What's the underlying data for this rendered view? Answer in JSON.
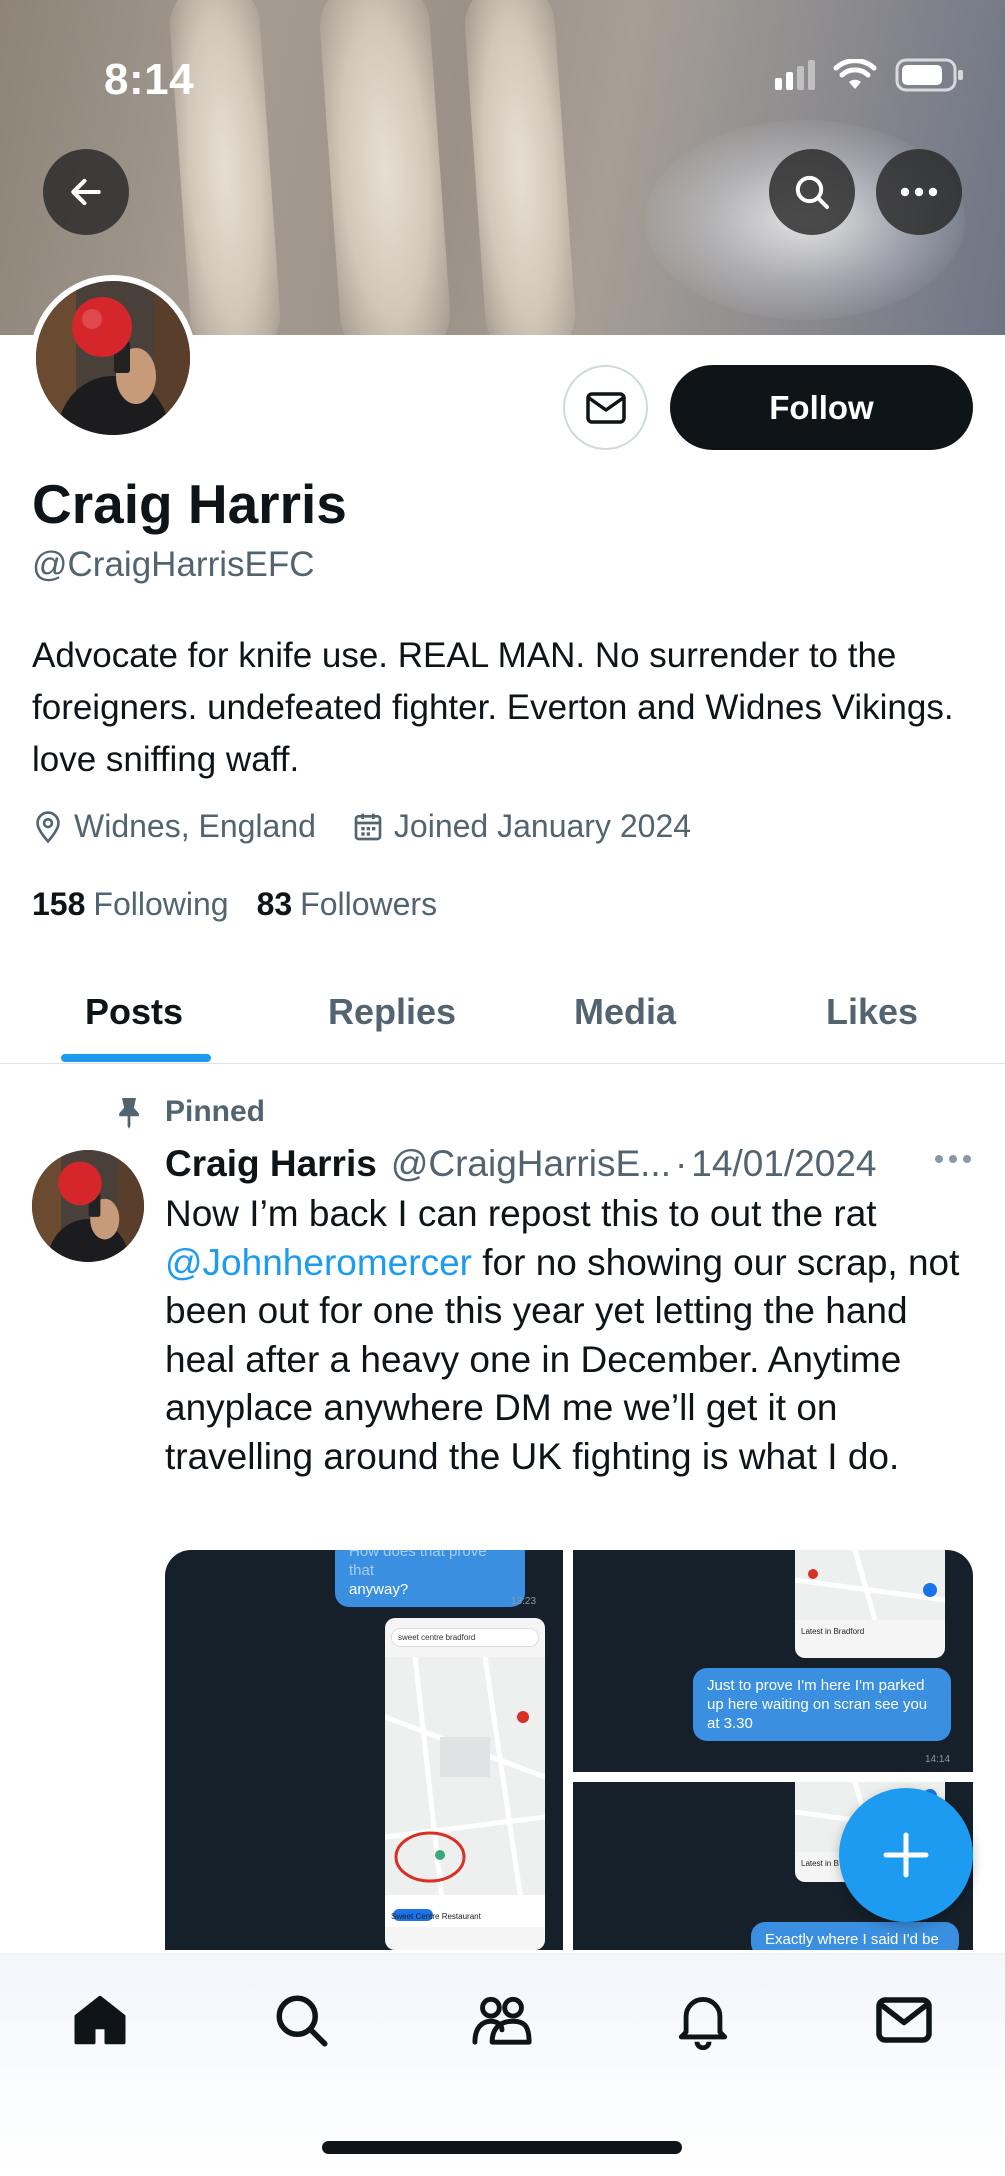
{
  "status_bar": {
    "time": "8:14"
  },
  "profile": {
    "name": "Craig Harris",
    "handle": "@CraigHarrisEFC",
    "bio": "Advocate for knife use. REAL MAN. No surrender to the foreigners. undefeated fighter. Everton and Widnes Vikings. love sniffing waff.",
    "location": "Widnes, England",
    "joined": "Joined January 2024",
    "following_count": "158",
    "following_label": "Following",
    "followers_count": "83",
    "followers_label": "Followers",
    "follow_label": "Follow"
  },
  "tabs": [
    {
      "label": "Posts",
      "active": true
    },
    {
      "label": "Replies",
      "active": false
    },
    {
      "label": "Media",
      "active": false
    },
    {
      "label": "Likes",
      "active": false
    }
  ],
  "pinned_post": {
    "pinned_label": "Pinned",
    "author_name": "Craig Harris",
    "author_handle": "@CraigHarrisE...",
    "separator": "·",
    "date": "14/01/2024",
    "text_before_mention": "Now I’m back I can repost this to out the rat ",
    "mention": "@Johnheromercer",
    "text_after_mention": " for no showing our scrap, not been out for one this year yet letting the hand heal after a heavy one in December. Anytime anyplace anywhere DM me we’ll get it on travelling around the UK fighting is what I do.",
    "media": {
      "img1_bubble": "anyway?",
      "img1_bubble_top": "How does that prove that",
      "img1_time": "13:23",
      "img1_search": "sweet centre bradford",
      "img1_place": "Sweet Centre Restaurant",
      "img2_bubble": "Just to prove I'm here I'm parked up here waiting on scran see you at 3.30",
      "img2_time": "14:14",
      "img2_map_label": "Latest in Bradford",
      "img3_bubble": "Exactly where I said I'd be",
      "img3_map_label": "Latest in B"
    }
  },
  "colors": {
    "accent": "#1d9bf0",
    "text": "#0f1419",
    "secondary": "#536471"
  },
  "icons": [
    "back-arrow-icon",
    "search-icon",
    "more-icon",
    "mail-icon",
    "location-pin-icon",
    "calendar-icon",
    "pin-icon",
    "plus-icon",
    "home-icon",
    "communities-icon",
    "notifications-icon"
  ]
}
